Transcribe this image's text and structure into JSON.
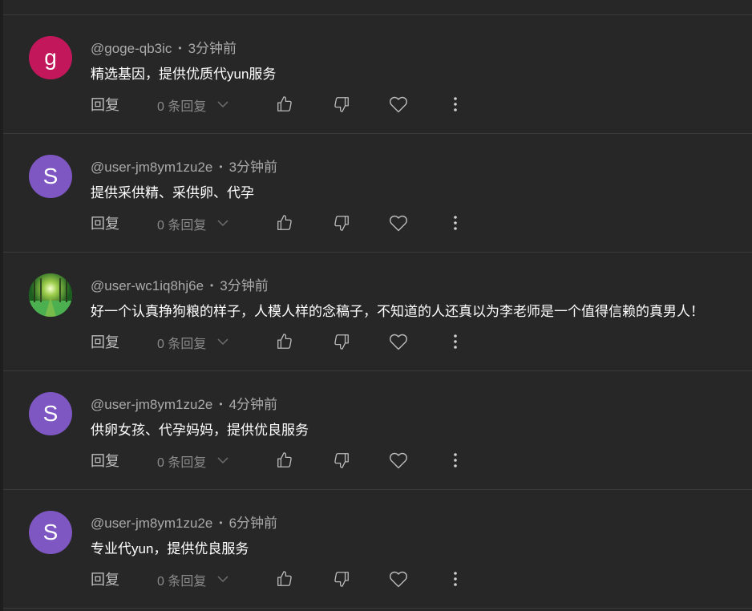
{
  "comments": [
    {
      "avatar_letter": "g",
      "avatar_color": "#c2185b",
      "avatar_type": "letter",
      "author": "@goge-qb3ic",
      "dot": "•",
      "time": "3分钟前",
      "text": "精选基因，提供优质代yun服务",
      "reply_label": "回复",
      "reply_count": "0 条回复"
    },
    {
      "avatar_letter": "S",
      "avatar_color": "#7e57c2",
      "avatar_type": "letter",
      "author": "@user-jm8ym1zu2e",
      "dot": "•",
      "time": "3分钟前",
      "text": "提供采供精、采供卵、代孕",
      "reply_label": "回复",
      "reply_count": "0 条回复"
    },
    {
      "avatar_letter": "",
      "avatar_color": "#2e7d32",
      "avatar_type": "image",
      "author": "@user-wc1iq8hj6e",
      "dot": "•",
      "time": "3分钟前",
      "text": "好一个认真挣狗粮的样子，人模人样的念稿子，不知道的人还真以为李老师是一个值得信赖的真男人！",
      "reply_label": "回复",
      "reply_count": "0 条回复"
    },
    {
      "avatar_letter": "S",
      "avatar_color": "#7e57c2",
      "avatar_type": "letter",
      "author": "@user-jm8ym1zu2e",
      "dot": "•",
      "time": "4分钟前",
      "text": "供卵女孩、代孕妈妈，提供优良服务",
      "reply_label": "回复",
      "reply_count": "0 条回复"
    },
    {
      "avatar_letter": "S",
      "avatar_color": "#7e57c2",
      "avatar_type": "letter",
      "author": "@user-jm8ym1zu2e",
      "dot": "•",
      "time": "6分钟前",
      "text": "专业代yun，提供优良服务",
      "reply_label": "回复",
      "reply_count": "0 条回复"
    }
  ],
  "icons": {
    "like": "thumbs-up-icon",
    "dislike": "thumbs-down-icon",
    "heart": "heart-icon",
    "more": "more-vertical-icon",
    "expand": "chevron-down-icon"
  },
  "colors": {
    "background": "#272727",
    "divider": "#3a3a3a",
    "meta_text": "#aaaaaa",
    "body_text": "#ffffff"
  }
}
